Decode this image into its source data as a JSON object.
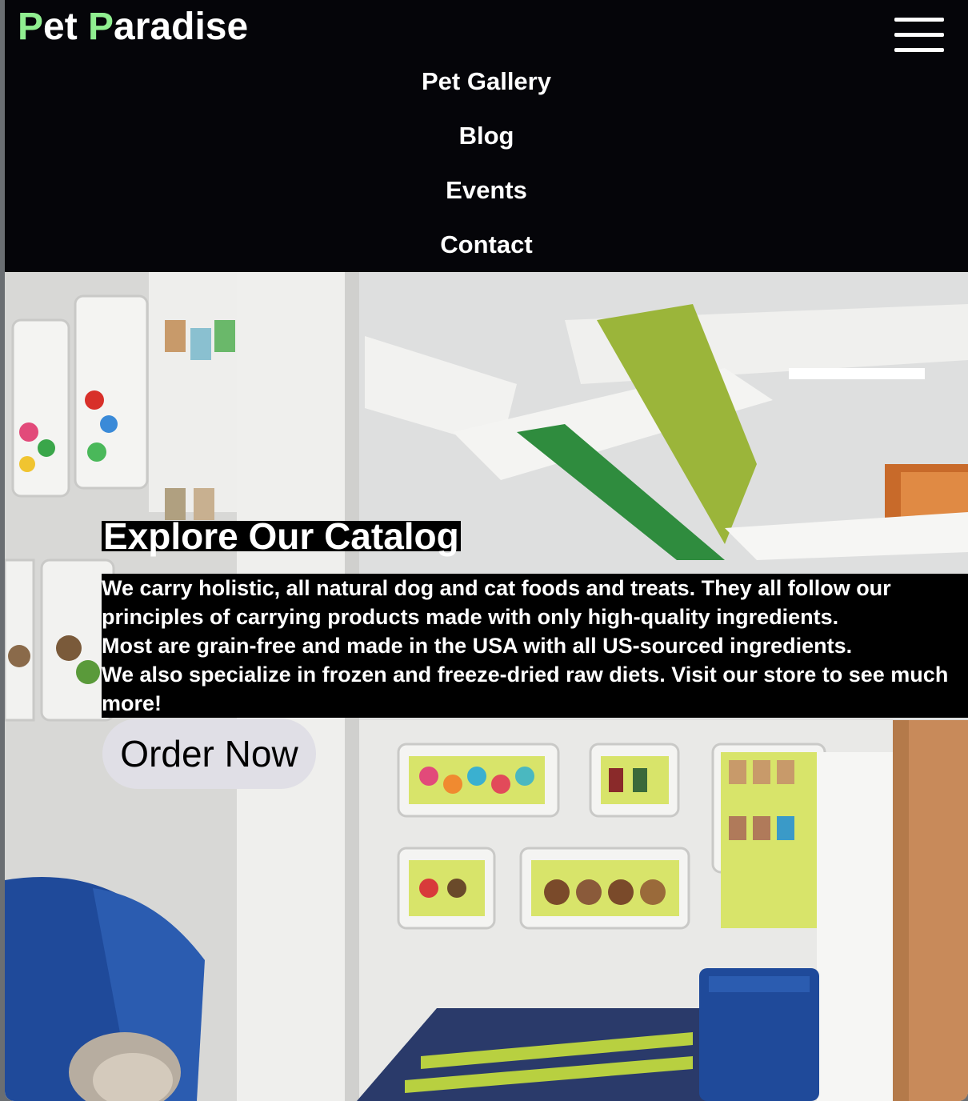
{
  "header": {
    "logo": {
      "initial_1": "P",
      "rest_1": "et ",
      "initial_2": "P",
      "rest_2": "aradise"
    },
    "menu_icon": "hamburger-menu-icon",
    "nav_items": [
      {
        "label": "Pet Gallery"
      },
      {
        "label": "Blog"
      },
      {
        "label": "Events"
      },
      {
        "label": "Contact"
      }
    ]
  },
  "hero": {
    "title": "Explore Our Catalog",
    "paragraphs": [
      "We carry holistic, all natural dog and cat foods and treats. They all follow our principles of carrying products made with only high-quality ingredients.",
      "Most are grain-free and made in the USA with all US-sourced ingredients.",
      "We also specialize in frozen and freeze-dried raw diets. Visit our store to see much more!"
    ],
    "button_label": "Order Now"
  },
  "colors": {
    "logo_accent": "#90ee90",
    "header_bg": "#050509",
    "text_highlight_bg": "#000000",
    "button_bg": "#e0dfe6"
  }
}
